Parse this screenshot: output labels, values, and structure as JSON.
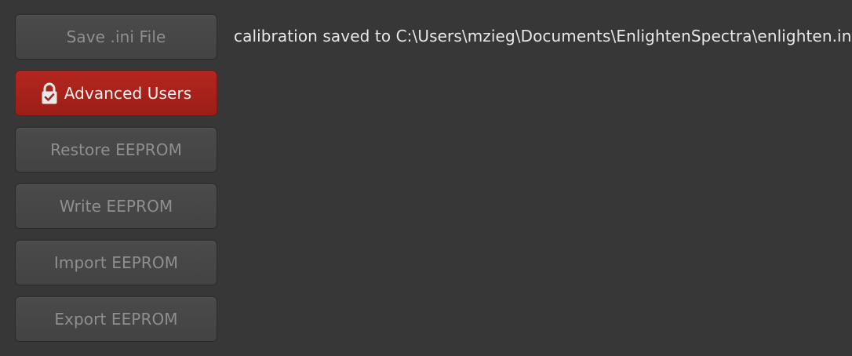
{
  "buttons": {
    "save_ini": "Save .ini File",
    "advanced_users": "Advanced Users",
    "restore_eeprom": "Restore EEPROM",
    "write_eeprom": "Write EEPROM",
    "import_eeprom": "Import EEPROM",
    "export_eeprom": "Export EEPROM"
  },
  "advanced_users_icon": "lock-check-icon",
  "status_message": "calibration saved to C:\\Users\\mzieg\\Documents\\EnlightenSpectra\\enlighten.ini",
  "colors": {
    "background": "#373737",
    "button": "#474747",
    "button_text_disabled": "#8f8f8f",
    "accent_red": "#a9221b",
    "text": "#e8e8e8"
  }
}
